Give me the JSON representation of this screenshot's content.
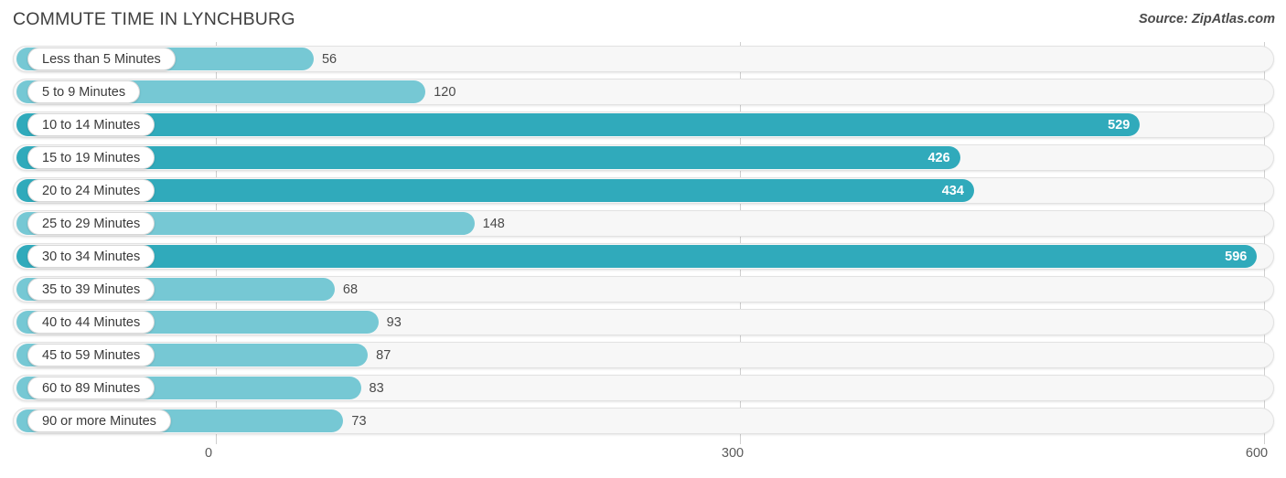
{
  "header": {
    "title": "COMMUTE TIME IN LYNCHBURG",
    "source": "Source: ZipAtlas.com"
  },
  "colors": {
    "bar_light": "#76c8d4",
    "bar_strong": "#30aabb",
    "track": "#f7f7f7",
    "gridline": "#cfcfcf",
    "text": "#3a3a3a"
  },
  "chart_data": {
    "type": "bar",
    "orientation": "horizontal",
    "title": "COMMUTE TIME IN LYNCHBURG",
    "xlabel": "",
    "ylabel": "",
    "xlim": [
      0,
      600
    ],
    "xticks": [
      "0",
      "300",
      "600"
    ],
    "xtick_values": [
      0,
      300,
      600
    ],
    "grid": true,
    "legend": false,
    "categories": [
      "Less than 5 Minutes",
      "5 to 9 Minutes",
      "10 to 14 Minutes",
      "15 to 19 Minutes",
      "20 to 24 Minutes",
      "25 to 29 Minutes",
      "30 to 34 Minutes",
      "35 to 39 Minutes",
      "40 to 44 Minutes",
      "45 to 59 Minutes",
      "60 to 89 Minutes",
      "90 or more Minutes"
    ],
    "values": [
      56,
      120,
      529,
      426,
      434,
      148,
      596,
      68,
      93,
      87,
      83,
      73
    ],
    "bars": [
      {
        "label": "Less than 5 Minutes",
        "value": 56,
        "value_text": "56",
        "strong": false,
        "inside": false
      },
      {
        "label": "5 to 9 Minutes",
        "value": 120,
        "value_text": "120",
        "strong": false,
        "inside": false
      },
      {
        "label": "10 to 14 Minutes",
        "value": 529,
        "value_text": "529",
        "strong": true,
        "inside": true
      },
      {
        "label": "15 to 19 Minutes",
        "value": 426,
        "value_text": "426",
        "strong": true,
        "inside": true
      },
      {
        "label": "20 to 24 Minutes",
        "value": 434,
        "value_text": "434",
        "strong": true,
        "inside": true
      },
      {
        "label": "25 to 29 Minutes",
        "value": 148,
        "value_text": "148",
        "strong": false,
        "inside": false
      },
      {
        "label": "30 to 34 Minutes",
        "value": 596,
        "value_text": "596",
        "strong": true,
        "inside": true
      },
      {
        "label": "35 to 39 Minutes",
        "value": 68,
        "value_text": "68",
        "strong": false,
        "inside": false
      },
      {
        "label": "40 to 44 Minutes",
        "value": 93,
        "value_text": "93",
        "strong": false,
        "inside": false
      },
      {
        "label": "45 to 59 Minutes",
        "value": 87,
        "value_text": "87",
        "strong": false,
        "inside": false
      },
      {
        "label": "60 to 89 Minutes",
        "value": 83,
        "value_text": "83",
        "strong": false,
        "inside": false
      },
      {
        "label": "90 or more Minutes",
        "value": 73,
        "value_text": "73",
        "strong": false,
        "inside": false
      }
    ]
  }
}
